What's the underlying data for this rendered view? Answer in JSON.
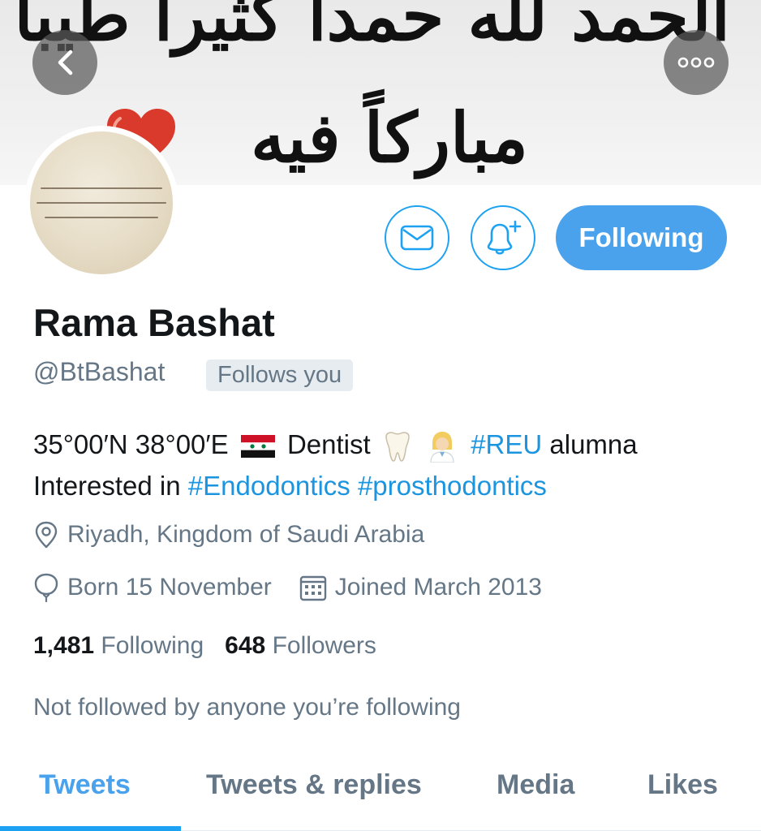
{
  "banner": {
    "line1": "الحمد لله حمداً كثيراً طيباً",
    "line2": "مباركاً فيه"
  },
  "profile": {
    "name": "Rama Bashat",
    "handle": "@BtBashat",
    "follows_you_badge": "Follows you",
    "bio": {
      "line1": {
        "coords": "35°00′N 38°00′E",
        "profession": "Dentist",
        "hashtag": "#REU",
        "suffix": "alumna"
      },
      "line2": {
        "prefix": "Interested in",
        "hashtag1": "#Endodontics",
        "hashtag2": "#prosthodontics"
      }
    },
    "location": "Riyadh, Kingdom of Saudi Arabia",
    "born": "Born 15 November",
    "joined": "Joined March 2013",
    "following_count": "1,481",
    "following_label": "Following",
    "followers_count": "648",
    "followers_label": "Followers",
    "mutuals_text": "Not followed by anyone you’re following"
  },
  "actions": {
    "follow_label": "Following"
  },
  "tabs": [
    {
      "label": "Tweets",
      "active": true
    },
    {
      "label": "Tweets & replies",
      "active": false
    },
    {
      "label": "Media",
      "active": false
    },
    {
      "label": "Likes",
      "active": false
    }
  ],
  "icons": {
    "back": "chevron-left-icon",
    "more": "more-horizontal-icon",
    "message": "envelope-icon",
    "notify": "bell-plus-icon",
    "location": "location-pin-icon",
    "born": "balloon-icon",
    "joined": "calendar-icon"
  },
  "colors": {
    "accent": "#1da1f2",
    "follow_button": "#4aa1ec",
    "secondary_text": "#657786",
    "hashtag": "#1b95e0",
    "badge_bg": "#e6ecf0"
  }
}
